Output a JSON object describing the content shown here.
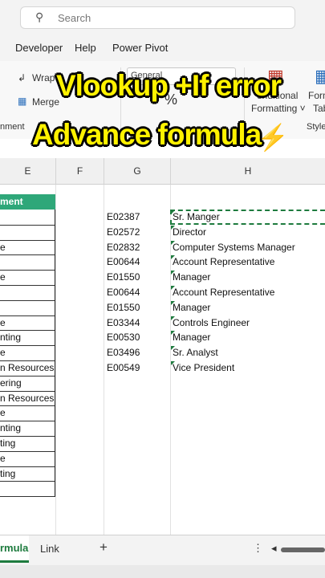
{
  "search": {
    "placeholder": "Search"
  },
  "menu": [
    "Developer",
    "Help",
    "Power Pivot"
  ],
  "ribbon": {
    "wrap": "Wrap",
    "merge": "Merge",
    "number_format": "General",
    "group_alignment": "nment",
    "conditional": "onditional",
    "formatting": "Formatting ˅",
    "form": "Form",
    "tab": "Tab",
    "styles": "Style"
  },
  "overlay": {
    "line1": "Vlookup +If error",
    "line2": "Advance formula",
    "bolt": "⚡"
  },
  "columns": [
    "E",
    "F",
    "G",
    "H"
  ],
  "e_col": {
    "header": "ment",
    "cells": [
      "",
      "",
      "e",
      "",
      "e",
      "",
      "",
      "e",
      "nting",
      "e",
      "n Resources",
      "ering",
      "n Resources",
      "e",
      "nting",
      "ting",
      "e",
      "ting",
      ""
    ]
  },
  "g_col": [
    "E02387",
    "E02572",
    "E02832",
    "E00644",
    "E01550",
    "E00644",
    "E01550",
    "E03344",
    "E00530",
    "E03496",
    "E00549"
  ],
  "h_col": [
    "Sr. Manger",
    "Director",
    "Computer Systems Manager",
    "Account Representative",
    "Manager",
    "Account Representative",
    "Manager",
    "Controls Engineer",
    "Manager",
    "Sr. Analyst",
    "Vice President"
  ],
  "sheet_tabs": {
    "active": "rmula",
    "other": "Link",
    "add": "+",
    "more": "⋮",
    "left": "◂"
  }
}
